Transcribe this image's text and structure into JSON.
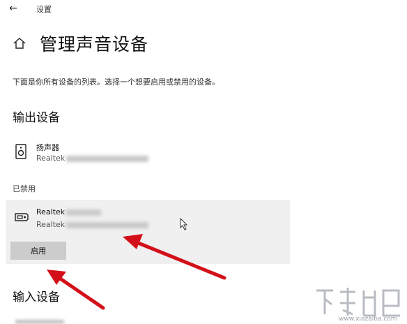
{
  "titlebar": {
    "back_icon": "back-arrow-icon",
    "title": "设置"
  },
  "header": {
    "home_icon": "home-icon",
    "title": "管理声音设备"
  },
  "description": "下面是你所有设备的列表。选择一个想要启用或禁用的设备。",
  "output": {
    "heading": "输出设备",
    "devices": [
      {
        "name": "扬声器",
        "subtitle": "Realtek",
        "icon": "speaker-icon"
      }
    ],
    "disabled_label": "已禁用",
    "disabled_devices": [
      {
        "name": "Realtek",
        "subtitle": "Realtek",
        "icon": "spdif-icon",
        "button_label": "启用"
      }
    ]
  },
  "input": {
    "heading": "输入设备"
  },
  "watermark": {
    "url": "www.xiazaiba.com"
  },
  "colors": {
    "panel": "#f0f0f0",
    "button": "#cccccc",
    "arrow": "#d3101a"
  }
}
